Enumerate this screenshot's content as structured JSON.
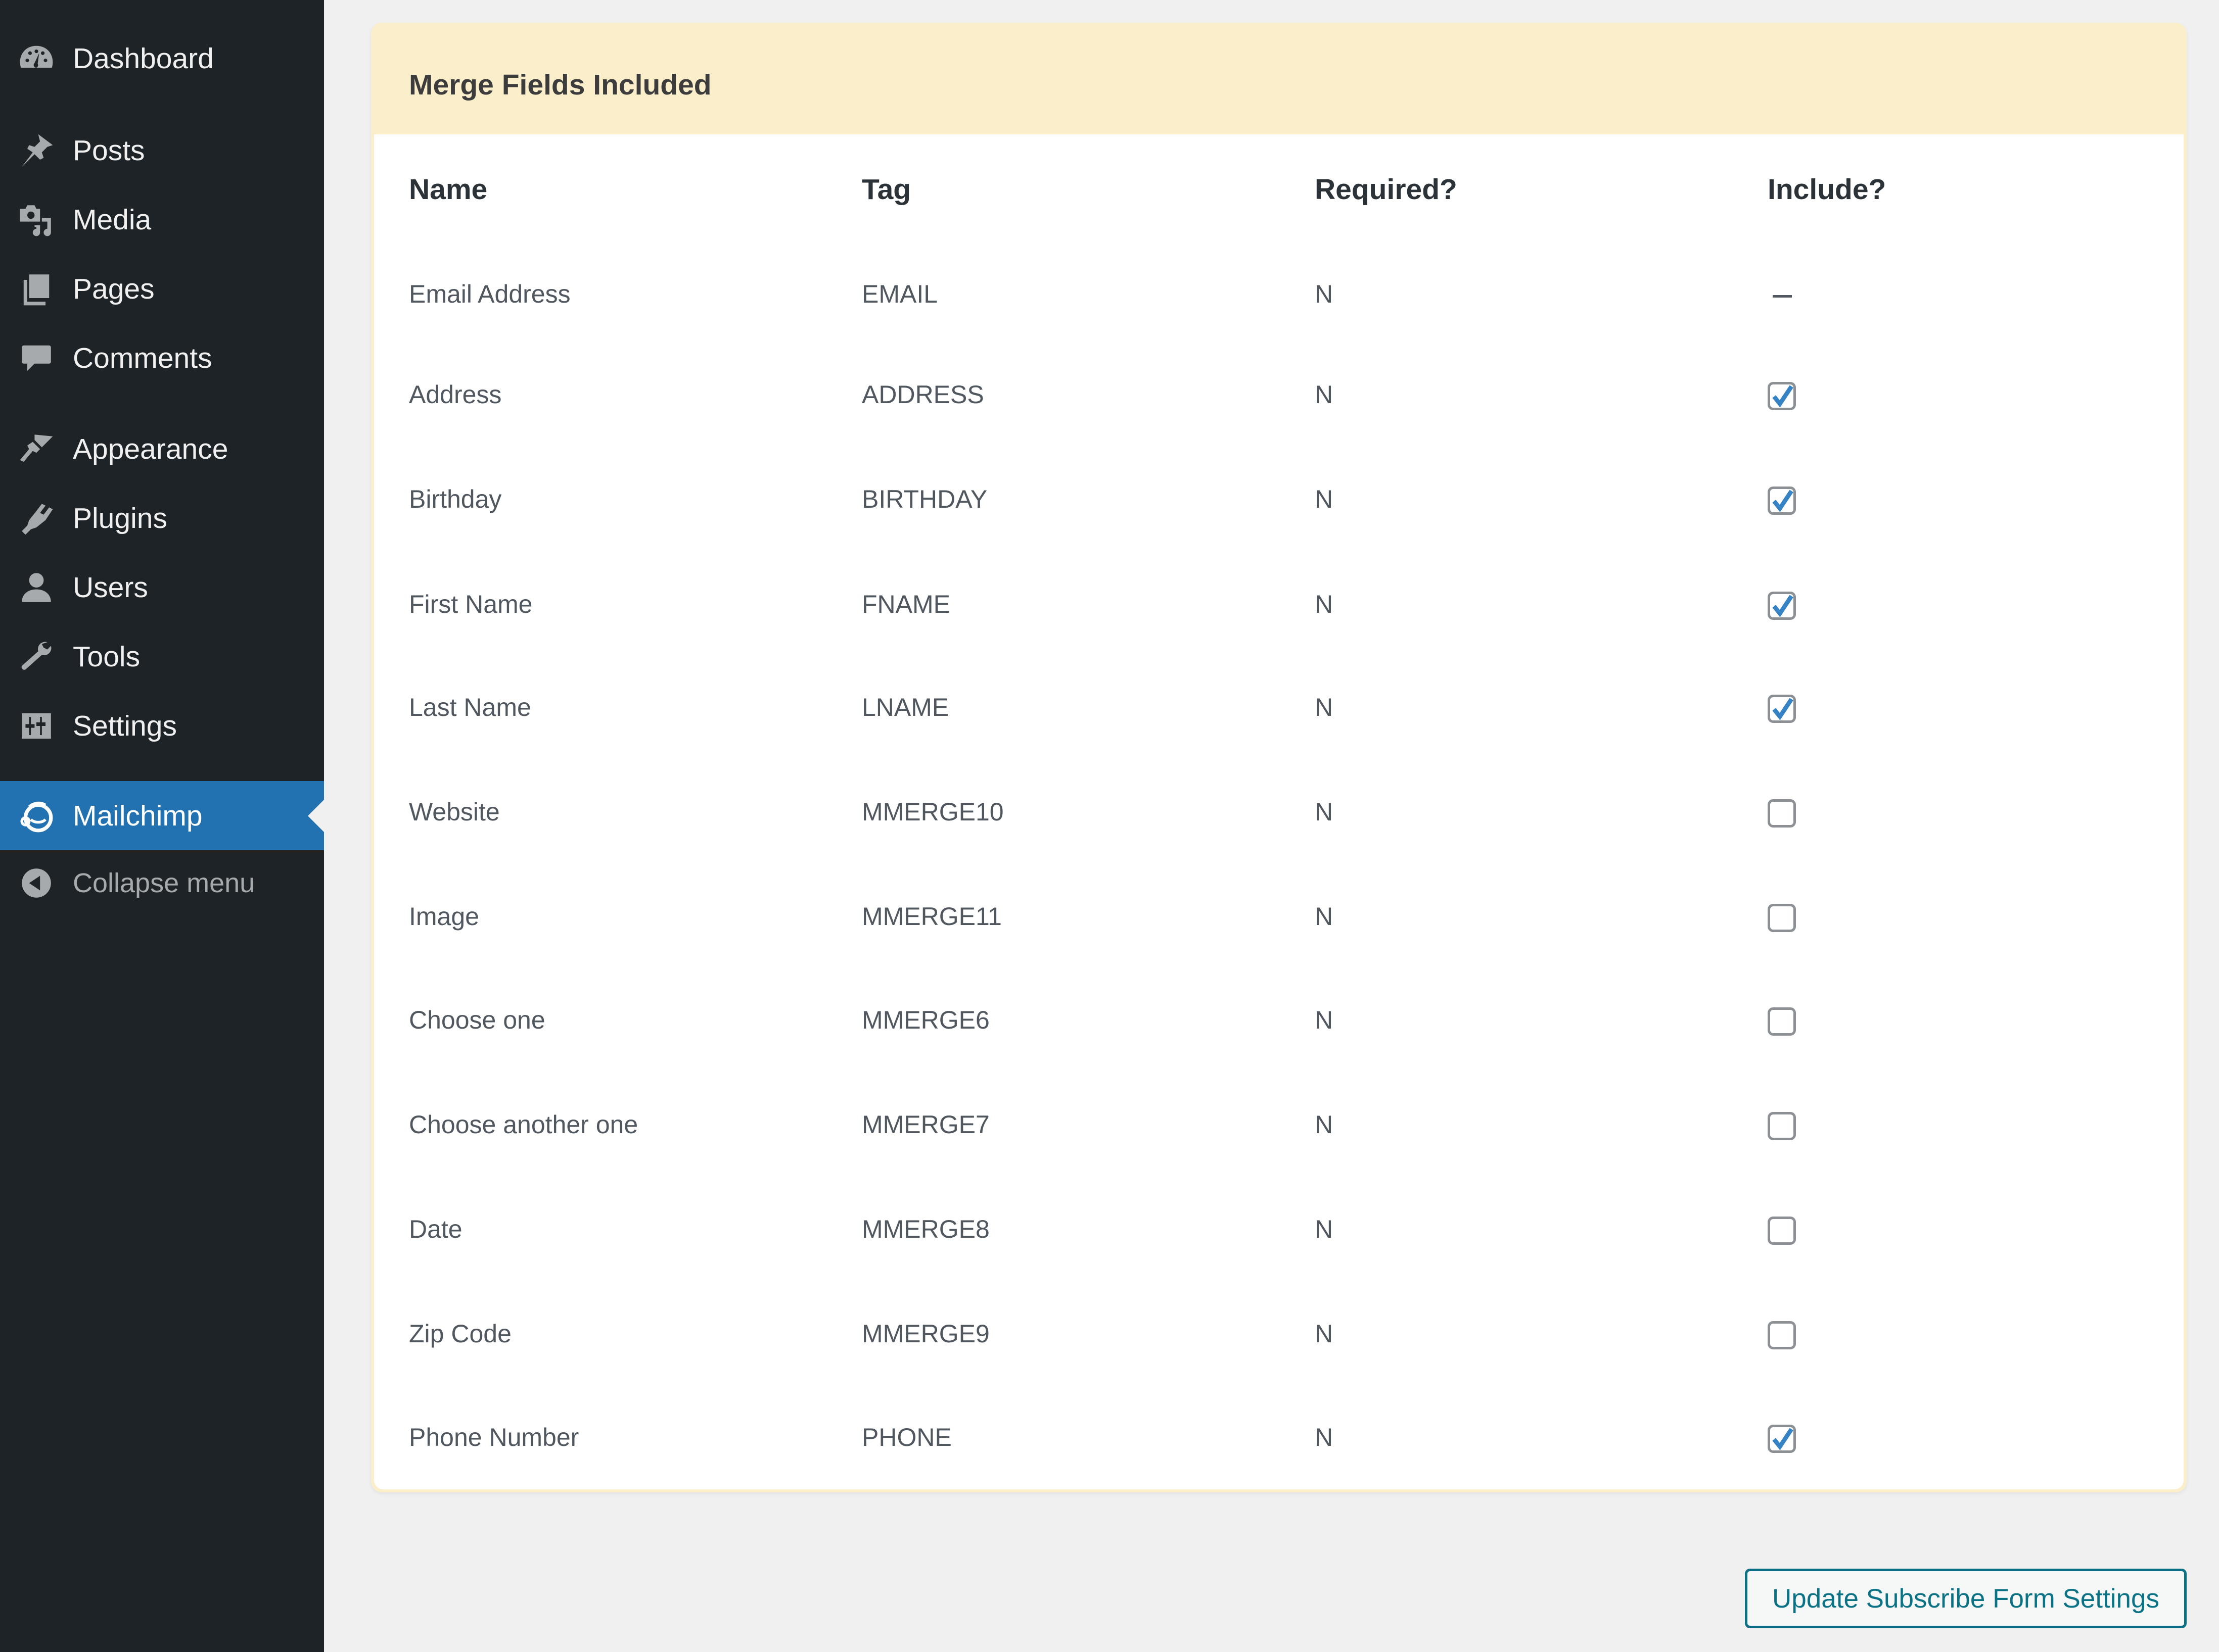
{
  "sidebar": {
    "items": [
      {
        "label": "Dashboard",
        "icon": "dashboard-icon"
      },
      {
        "label": "Posts",
        "icon": "pushpin-icon"
      },
      {
        "label": "Media",
        "icon": "media-icon"
      },
      {
        "label": "Pages",
        "icon": "pages-icon"
      },
      {
        "label": "Comments",
        "icon": "comment-icon"
      },
      {
        "label": "Appearance",
        "icon": "paintbrush-icon"
      },
      {
        "label": "Plugins",
        "icon": "plugin-icon"
      },
      {
        "label": "Users",
        "icon": "user-icon"
      },
      {
        "label": "Tools",
        "icon": "wrench-icon"
      },
      {
        "label": "Settings",
        "icon": "settings-sliders-icon"
      },
      {
        "label": "Mailchimp",
        "icon": "mailchimp-icon",
        "active": true
      },
      {
        "label": "Collapse menu",
        "icon": "collapse-arrow-icon"
      }
    ],
    "active_color": "#2271b1"
  },
  "card": {
    "title": "Merge Fields Included",
    "columns": [
      "Name",
      "Tag",
      "Required?",
      "Include?"
    ],
    "rows": [
      {
        "name": "Email Address",
        "tag": "EMAIL",
        "required": "N",
        "include": "locked"
      },
      {
        "name": "Address",
        "tag": "ADDRESS",
        "required": "N",
        "include": true
      },
      {
        "name": "Birthday",
        "tag": "BIRTHDAY",
        "required": "N",
        "include": true
      },
      {
        "name": "First Name",
        "tag": "FNAME",
        "required": "N",
        "include": true
      },
      {
        "name": "Last Name",
        "tag": "LNAME",
        "required": "N",
        "include": true
      },
      {
        "name": "Website",
        "tag": "MMERGE10",
        "required": "N",
        "include": false
      },
      {
        "name": "Image",
        "tag": "MMERGE11",
        "required": "N",
        "include": false
      },
      {
        "name": "Choose one",
        "tag": "MMERGE6",
        "required": "N",
        "include": false
      },
      {
        "name": "Choose another one",
        "tag": "MMERGE7",
        "required": "N",
        "include": false
      },
      {
        "name": "Date",
        "tag": "MMERGE8",
        "required": "N",
        "include": false
      },
      {
        "name": "Zip Code",
        "tag": "MMERGE9",
        "required": "N",
        "include": false
      },
      {
        "name": "Phone Number",
        "tag": "PHONE",
        "required": "N",
        "include": true
      }
    ],
    "locked_marker": "—"
  },
  "footer": {
    "update_button_label": "Update Subscribe Form Settings",
    "button_color": "#0a7285"
  }
}
